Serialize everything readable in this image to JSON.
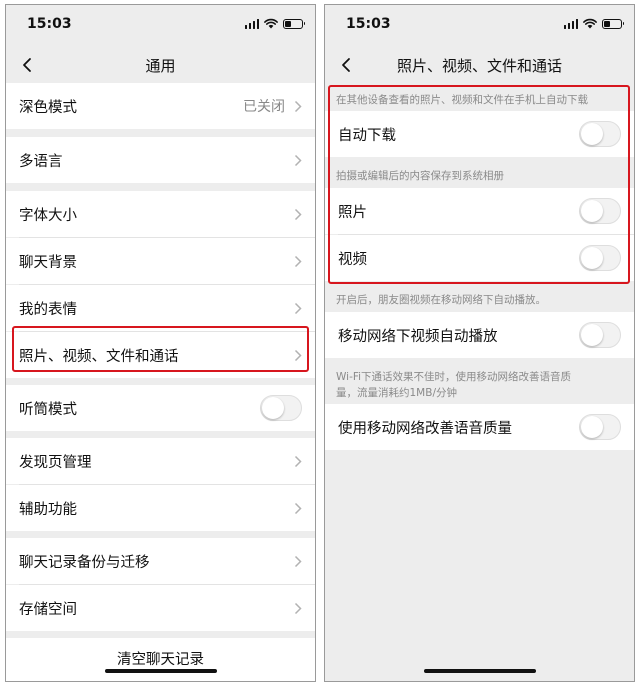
{
  "colors": {
    "highlight": "#d7161e",
    "background": "#ededed",
    "row": "#ffffff",
    "muted_text": "#8a8a8a"
  },
  "left": {
    "status": {
      "time": "15:03"
    },
    "nav": {
      "title": "通用",
      "back_icon": "chevron-left-icon"
    },
    "items": {
      "dark_mode": {
        "label": "深色模式",
        "value": "已关闭"
      },
      "language": {
        "label": "多语言"
      },
      "font_size": {
        "label": "字体大小"
      },
      "chat_background": {
        "label": "聊天背景"
      },
      "stickers": {
        "label": "我的表情"
      },
      "media": {
        "label": "照片、视频、文件和通话"
      },
      "earpiece": {
        "label": "听筒模式",
        "toggle": false
      },
      "discover": {
        "label": "发现页管理"
      },
      "accessibility": {
        "label": "辅助功能"
      },
      "backup": {
        "label": "聊天记录备份与迁移"
      },
      "storage": {
        "label": "存储空间"
      },
      "clear": {
        "label": "清空聊天记录"
      }
    }
  },
  "right": {
    "status": {
      "time": "15:03"
    },
    "nav": {
      "title": "照片、视频、文件和通话",
      "back_icon": "chevron-left-icon"
    },
    "notes": {
      "auto_download": "在其他设备查看的照片、视频和文件在手机上自动下载",
      "save_album": "拍摄或编辑后的内容保存到系统相册",
      "moments": "开启后，朋友圈视频在移动网络下自动播放。",
      "wifi_line1": "Wi-Fi下通话效果不佳时，使用移动网络改善语音质",
      "wifi_line2": "量，流量消耗约1MB/分钟"
    },
    "items": {
      "auto_download": {
        "label": "自动下载",
        "toggle": false
      },
      "photos": {
        "label": "照片",
        "toggle": false
      },
      "videos": {
        "label": "视频",
        "toggle": false
      },
      "mobile_autoplay": {
        "label": "移动网络下视频自动播放",
        "toggle": false
      },
      "voice_quality": {
        "label": "使用移动网络改善语音质量",
        "toggle": false
      }
    }
  }
}
